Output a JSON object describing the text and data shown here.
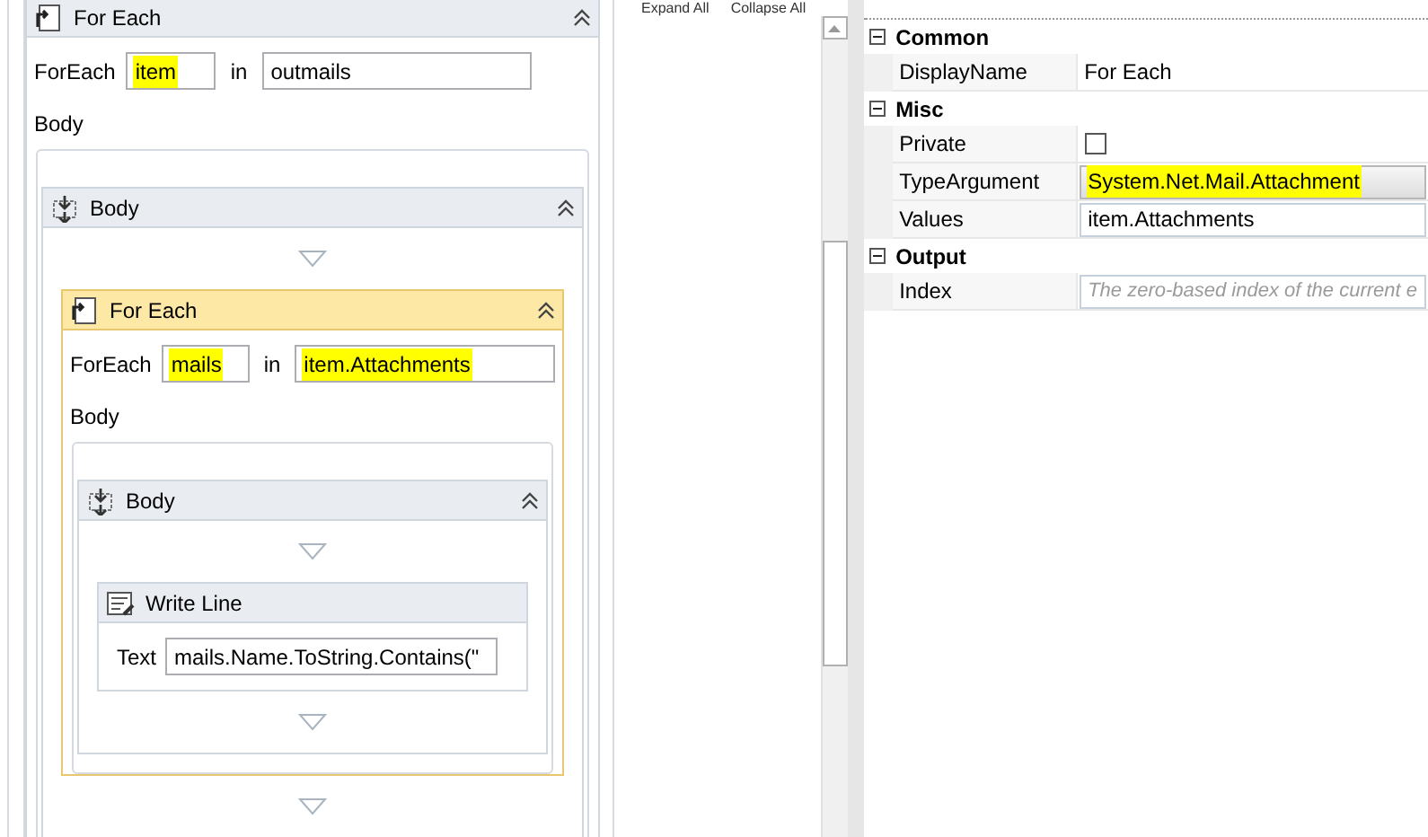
{
  "toolbar": {
    "expand": "Expand All",
    "collapse": "Collapse All"
  },
  "designer": {
    "kind": "foreach",
    "title": "For Each",
    "selected": false,
    "foreach_label": "ForEach",
    "variable": {
      "value": "item",
      "highlighted": true
    },
    "in_label": "in",
    "collection": {
      "value": "outmails",
      "highlighted": false
    },
    "body_label": "Body",
    "body": {
      "kind": "sequence",
      "title": "Body",
      "children": [
        {
          "kind": "foreach",
          "title": "For Each",
          "selected": true,
          "foreach_label": "ForEach",
          "variable": {
            "value": "mails",
            "highlighted": true
          },
          "in_label": "in",
          "collection": {
            "value": "item.Attachments",
            "highlighted": true
          },
          "body_label": "Body",
          "body": {
            "kind": "sequence",
            "title": "Body",
            "children": [
              {
                "kind": "writeline",
                "title": "Write Line",
                "text_label": "Text",
                "text": {
                  "value": "mails.Name.ToString.Contains(\"",
                  "highlighted": false
                }
              }
            ]
          }
        }
      ]
    }
  },
  "properties": [
    {
      "name": "Common",
      "expanded": true,
      "rows": [
        {
          "name": "DisplayName",
          "kind": "text",
          "value": "For Each",
          "highlighted": false
        }
      ]
    },
    {
      "name": "Misc",
      "expanded": true,
      "rows": [
        {
          "name": "Private",
          "kind": "checkbox",
          "checked": false
        },
        {
          "name": "TypeArgument",
          "kind": "dropdown",
          "value": "System.Net.Mail.Attachment",
          "highlighted": true
        },
        {
          "name": "Values",
          "kind": "expression",
          "value": "item.Attachments",
          "highlighted": false
        }
      ]
    },
    {
      "name": "Output",
      "expanded": true,
      "rows": [
        {
          "name": "Index",
          "kind": "expression",
          "placeholder": "The zero-based index of the current e"
        }
      ]
    }
  ]
}
